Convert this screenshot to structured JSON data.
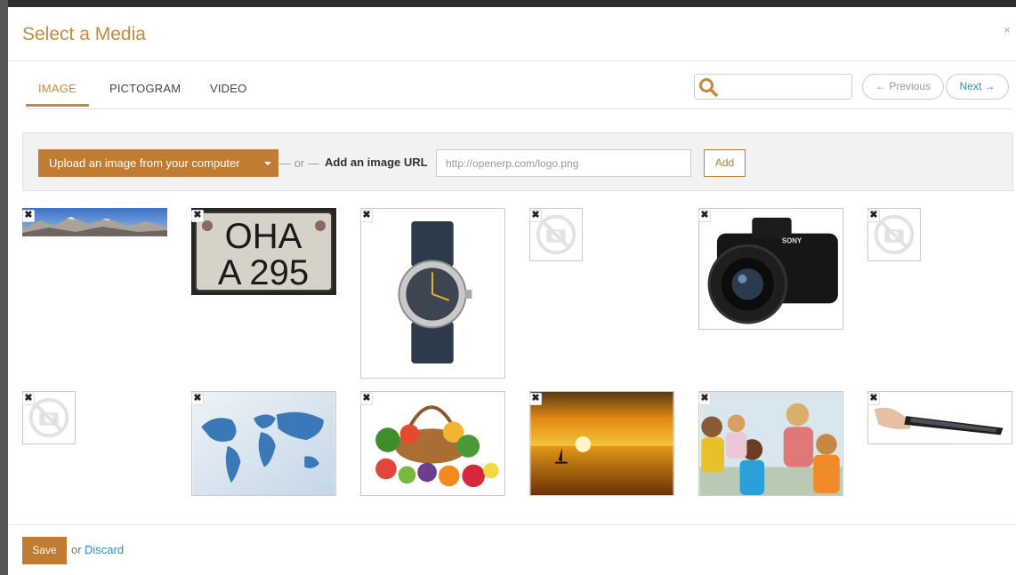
{
  "dialog": {
    "title": "Select a Media",
    "close": "×"
  },
  "tabs": [
    {
      "label": "IMAGE",
      "active": true
    },
    {
      "label": "PICTOGRAM",
      "active": false
    },
    {
      "label": "VIDEO",
      "active": false
    }
  ],
  "search": {
    "placeholder": "",
    "icon": "search-icon"
  },
  "pager": {
    "previous": "← Previous",
    "next": "Next →"
  },
  "upload": {
    "button_label": "Upload an image from your computer",
    "or_text": "— or —",
    "url_label": "Add an image URL",
    "url_placeholder": "http://openerp.com/logo.png",
    "add_label": "Add"
  },
  "media": [
    {
      "name": "panorama-mountain-image"
    },
    {
      "name": "license-plate-image",
      "text_line1": "OHA",
      "text_line2": "A 295"
    },
    {
      "name": "wristwatch-image"
    },
    {
      "name": "placeholder-image"
    },
    {
      "name": "dslr-camera-image",
      "brand": "SONY"
    },
    {
      "name": "placeholder-image"
    },
    {
      "name": "placeholder-image"
    },
    {
      "name": "world-map-image"
    },
    {
      "name": "fruit-basket-image"
    },
    {
      "name": "sunset-sea-image"
    },
    {
      "name": "classroom-children-image"
    },
    {
      "name": "tablet-hand-image"
    }
  ],
  "remove_glyph": "✖",
  "footer": {
    "save_label": "Save",
    "or_text": "or",
    "discard_label": "Discard"
  },
  "colors": {
    "accent": "#c17c33",
    "title": "#c48a42",
    "link": "#2a8fc9"
  }
}
